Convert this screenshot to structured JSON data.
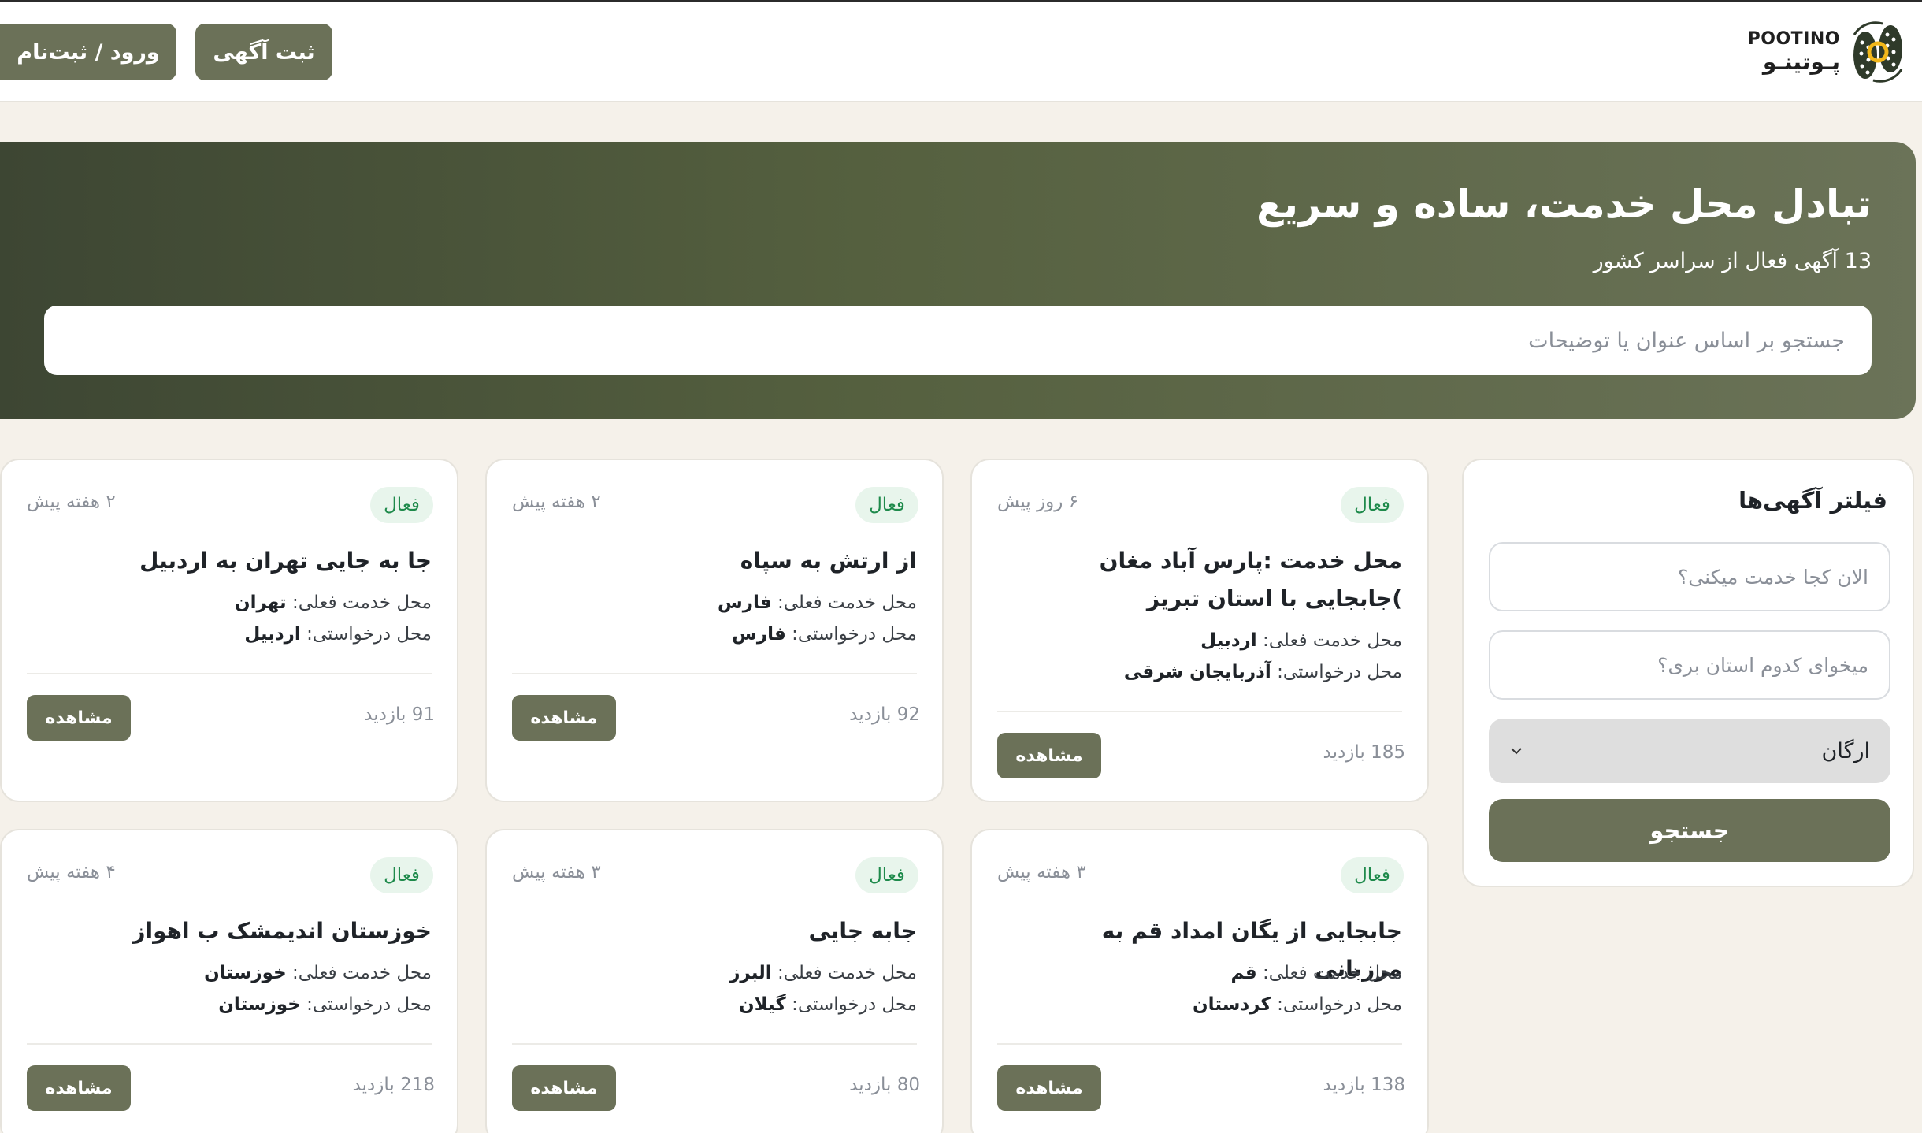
{
  "header": {
    "logo_en": "POOTINO",
    "logo_fa": "پـوتینـو",
    "post_button": "ثبت آگهی",
    "login_button": "ورود / ثبت‌نام"
  },
  "hero": {
    "title": "تبادل محل خدمت، ساده و سریع",
    "subtitle": "13 آگهی فعال از سراسر کشور",
    "search_placeholder": "جستجو بر اساس عنوان یا توضیحات"
  },
  "filter": {
    "title": "فیلتر آگهی‌ها",
    "current_placeholder": "الان کجا خدمت میکنی؟",
    "desired_placeholder": "میخوای کدوم استان بری؟",
    "org_selected": "ارگان",
    "search_button": "جستجو"
  },
  "labels": {
    "current": "محل خدمت فعلی:",
    "desired": "محل درخواستی:",
    "view_button": "مشاهده"
  },
  "cards": [
    {
      "status": "فعال",
      "time": "۶ روز پیش",
      "title": "محل خدمت :پارس آباد مغان )جابجایی با استان تبریز",
      "current": "اردبیل",
      "desired": "آذربایجان شرقی",
      "views": "185 بازدید"
    },
    {
      "status": "فعال",
      "time": "۲ هفته پیش",
      "title": "از ارتش به سپاه",
      "current": "فارس",
      "desired": "فارس",
      "views": "92 بازدید"
    },
    {
      "status": "فعال",
      "time": "۲ هفته پیش",
      "title": "جا به جایی تهران به اردبیل",
      "current": "تهران",
      "desired": "اردبیل",
      "views": "91 بازدید"
    },
    {
      "status": "فعال",
      "time": "۳ هفته پیش",
      "title": "جابجایی از یگان امداد قم به مرزبانی",
      "current": "قم",
      "desired": "کردستان",
      "views": "138 بازدید"
    },
    {
      "status": "فعال",
      "time": "۳ هفته پیش",
      "title": "جابه جایی",
      "current": "البرز",
      "desired": "گیلان",
      "views": "80 بازدید"
    },
    {
      "status": "فعال",
      "time": "۴ هفته پیش",
      "title": "خوزستان اندیمشک ب اهواز",
      "current": "خوزستان",
      "desired": "خوزستان",
      "views": "218 بازدید"
    }
  ]
}
